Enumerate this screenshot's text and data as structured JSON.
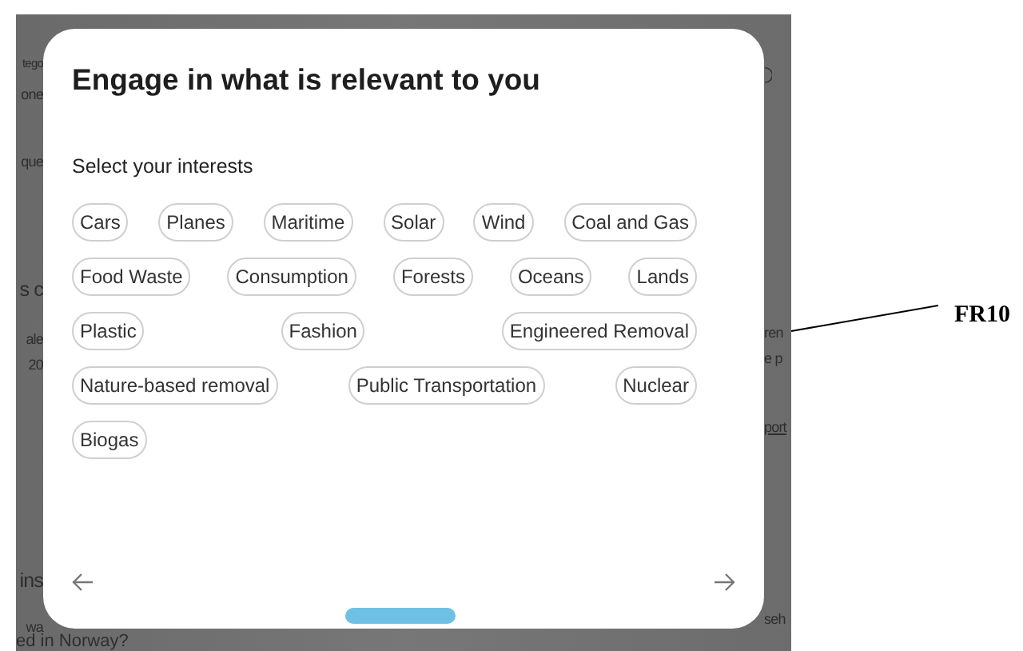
{
  "background_left": [
    {
      "text": "tego",
      "kind": "small"
    },
    {
      "text": "one",
      "kind": "label"
    },
    {
      "text": "que",
      "kind": "label"
    },
    {
      "text": "s c",
      "kind": "heading"
    },
    {
      "text": "ale",
      "kind": "label"
    },
    {
      "text": "20",
      "kind": "label"
    },
    {
      "text": "ins",
      "kind": "heading"
    },
    {
      "text": "wa",
      "kind": "label"
    }
  ],
  "background_right": [
    {
      "text": "ren",
      "kind": "label"
    },
    {
      "text": "e p",
      "kind": "label"
    },
    {
      "text": "port",
      "kind": "link"
    },
    {
      "text": "seh",
      "kind": "label"
    }
  ],
  "background_bottom": "ed in Norway?",
  "dialog": {
    "title": "Engage in what is relevant to you",
    "subtitle": "Select your interests",
    "interest_rows": [
      [
        {
          "label": "Cars",
          "selected": false
        },
        {
          "label": "Planes",
          "selected": false
        },
        {
          "label": "Maritime",
          "selected": false
        },
        {
          "label": "Solar",
          "selected": false
        },
        {
          "label": "Wind",
          "selected": false
        },
        {
          "label": "Coal and Gas",
          "selected": false
        }
      ],
      [
        {
          "label": "Food Waste",
          "selected": false
        },
        {
          "label": "Consumption",
          "selected": false
        },
        {
          "label": "Forests",
          "selected": false
        },
        {
          "label": "Oceans",
          "selected": false
        },
        {
          "label": "Lands",
          "selected": false
        }
      ],
      [
        {
          "label": "Plastic",
          "selected": false
        },
        {
          "label": "Fashion",
          "selected": false
        },
        {
          "label": "Engineered Removal",
          "selected": false
        }
      ],
      [
        {
          "label": "Nature-based removal",
          "selected": false
        },
        {
          "label": "Public Transportation",
          "selected": false
        },
        {
          "label": "Nuclear",
          "selected": false
        }
      ],
      [
        {
          "label": "Biogas",
          "selected": false
        }
      ]
    ]
  },
  "annotation": {
    "label": "FR10"
  }
}
